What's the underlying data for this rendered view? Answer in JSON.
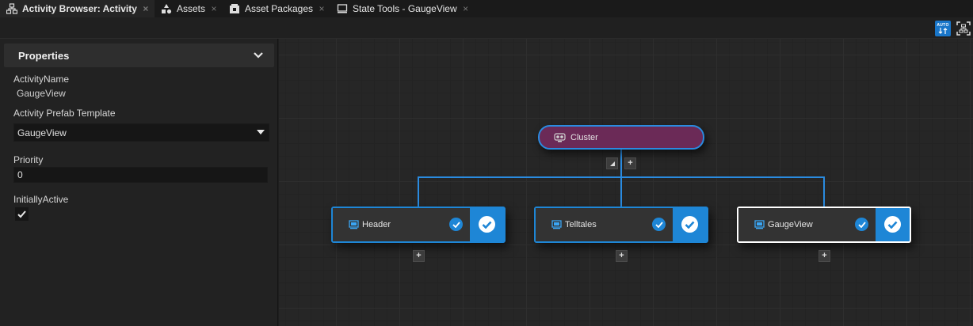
{
  "tabs": [
    {
      "label": "Activity Browser: Activity",
      "icon": "hierarchy-icon",
      "active": true
    },
    {
      "label": "Assets",
      "icon": "assets-icon",
      "active": false
    },
    {
      "label": "Asset Packages",
      "icon": "asset-packages-icon",
      "active": false
    },
    {
      "label": "State Tools - GaugeView",
      "icon": "monitor-icon",
      "active": false
    }
  ],
  "toolbar": {
    "auto_label": "AUTO",
    "auto_layout_color": "#1976c9",
    "fit_icon": "fit-to-view-icon"
  },
  "properties": {
    "title": "Properties",
    "activity_name_label": "ActivityName",
    "activity_name_value": "GaugeView",
    "prefab_label": "Activity Prefab Template",
    "prefab_value": "GaugeView",
    "priority_label": "Priority",
    "priority_value": "0",
    "initially_active_label": "InitiallyActive",
    "initially_active_checked": true
  },
  "graph": {
    "root": {
      "label": "Cluster",
      "icon": "cluster-icon",
      "color": "#6b2a57"
    },
    "children": [
      {
        "label": "Header",
        "icon": "screen-icon",
        "selected": false
      },
      {
        "label": "Telltales",
        "icon": "screen-icon",
        "selected": false
      },
      {
        "label": "GaugeView",
        "icon": "screen-icon",
        "selected": true
      }
    ],
    "accent_color": "#1e86d6",
    "selection_color": "#ffffff"
  }
}
